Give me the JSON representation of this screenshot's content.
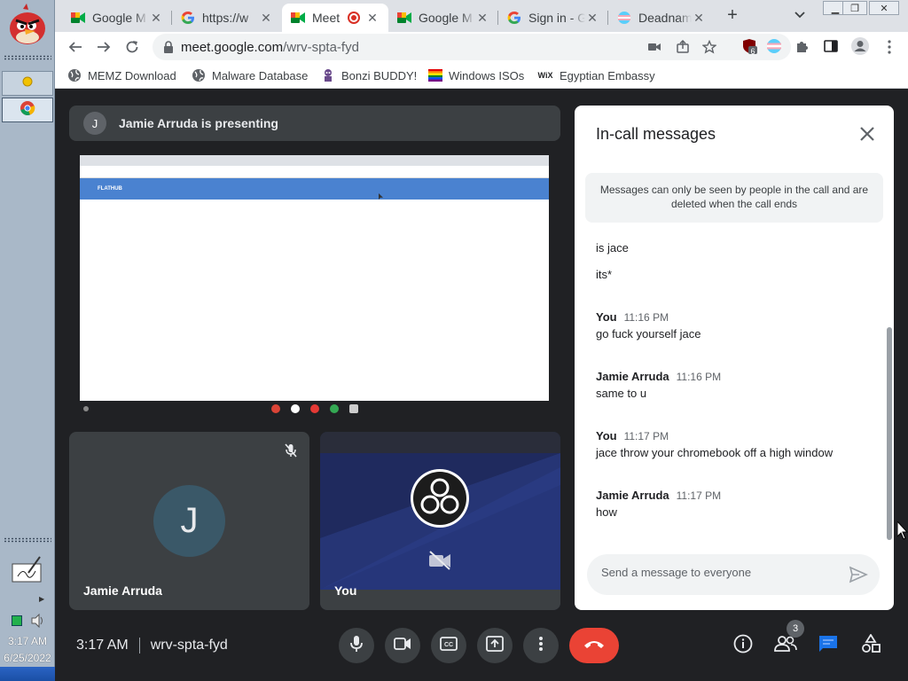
{
  "taskbar": {
    "time": "3:17 AM",
    "date": "6/25/2022"
  },
  "tabs": [
    {
      "title": "Google M",
      "icon": "meet-icon"
    },
    {
      "title": "https://w",
      "icon": "google-icon"
    },
    {
      "title": "Meet",
      "icon": "meet-icon",
      "active": true
    },
    {
      "title": "Google M",
      "icon": "meet-icon"
    },
    {
      "title": "Sign in - G",
      "icon": "google-icon"
    },
    {
      "title": "Deadnam",
      "icon": "flag-icon"
    }
  ],
  "omnibox": {
    "domain": "meet.google.com",
    "path": "/wrv-spta-fyd"
  },
  "extensions": {
    "badge": "6"
  },
  "bookmarks": [
    {
      "label": "MEMZ Download",
      "icon": "globe-icon"
    },
    {
      "label": "Malware Database",
      "icon": "globe-icon"
    },
    {
      "label": "Bonzi BUDDY!",
      "icon": "bonzi-icon"
    },
    {
      "label": "Windows ISOs",
      "icon": "rainbow-flag-icon"
    },
    {
      "label": "Egyptian Embassy",
      "icon": "wix-icon"
    }
  ],
  "presenting": {
    "avatar_initial": "J",
    "text": "Jamie Arruda is presenting"
  },
  "shared_screen": {
    "banner": "FLATHUB"
  },
  "tiles": {
    "jamie": {
      "name": "Jamie Arruda",
      "initial": "J"
    },
    "you": {
      "name": "You"
    }
  },
  "chat": {
    "title": "In-call messages",
    "notice": "Messages can only be seen by people in the call and are deleted when the call ends",
    "messages": [
      {
        "sender": "",
        "time": "",
        "text": "is jace"
      },
      {
        "sender": "",
        "time": "",
        "text": "its*"
      },
      {
        "sender": "You",
        "time": "11:16 PM",
        "text": "go fuck yourself jace"
      },
      {
        "sender": "Jamie Arruda",
        "time": "11:16 PM",
        "text": "same to u"
      },
      {
        "sender": "You",
        "time": "11:17 PM",
        "text": "jace throw your chromebook off a high window"
      },
      {
        "sender": "Jamie Arruda",
        "time": "11:17 PM",
        "text": "how"
      }
    ],
    "composer_placeholder": "Send a message to everyone"
  },
  "bottom": {
    "time": "3:17 AM",
    "meeting_code": "wrv-spta-fyd",
    "participant_count": "3"
  },
  "colors": {
    "meet_bg": "#202124",
    "end_call": "#ea4335",
    "chat_accent": "#1a73e8"
  }
}
